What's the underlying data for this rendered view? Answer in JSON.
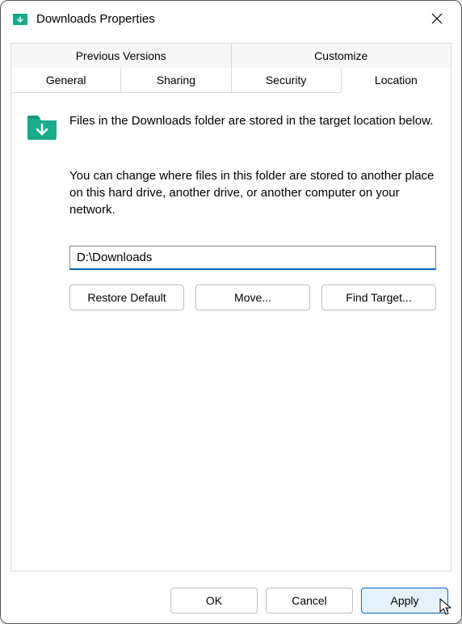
{
  "titlebar": {
    "title": "Downloads Properties"
  },
  "tabs": {
    "row1": [
      {
        "label": "Previous Versions"
      },
      {
        "label": "Customize"
      }
    ],
    "row2": [
      {
        "label": "General"
      },
      {
        "label": "Sharing"
      },
      {
        "label": "Security"
      },
      {
        "label": "Location"
      }
    ],
    "active": "Location"
  },
  "panel": {
    "info": "Files in the Downloads folder are stored in the target location below.",
    "desc": "You can change where files in this folder are stored to another place on this hard drive, another drive, or another computer on your network.",
    "path_value": "D:\\Downloads",
    "buttons": {
      "restore": "Restore Default",
      "move": "Move...",
      "find": "Find Target..."
    }
  },
  "footer": {
    "ok": "OK",
    "cancel": "Cancel",
    "apply": "Apply"
  },
  "colors": {
    "accent": "#0067c0",
    "folder": "#1aab8b"
  }
}
